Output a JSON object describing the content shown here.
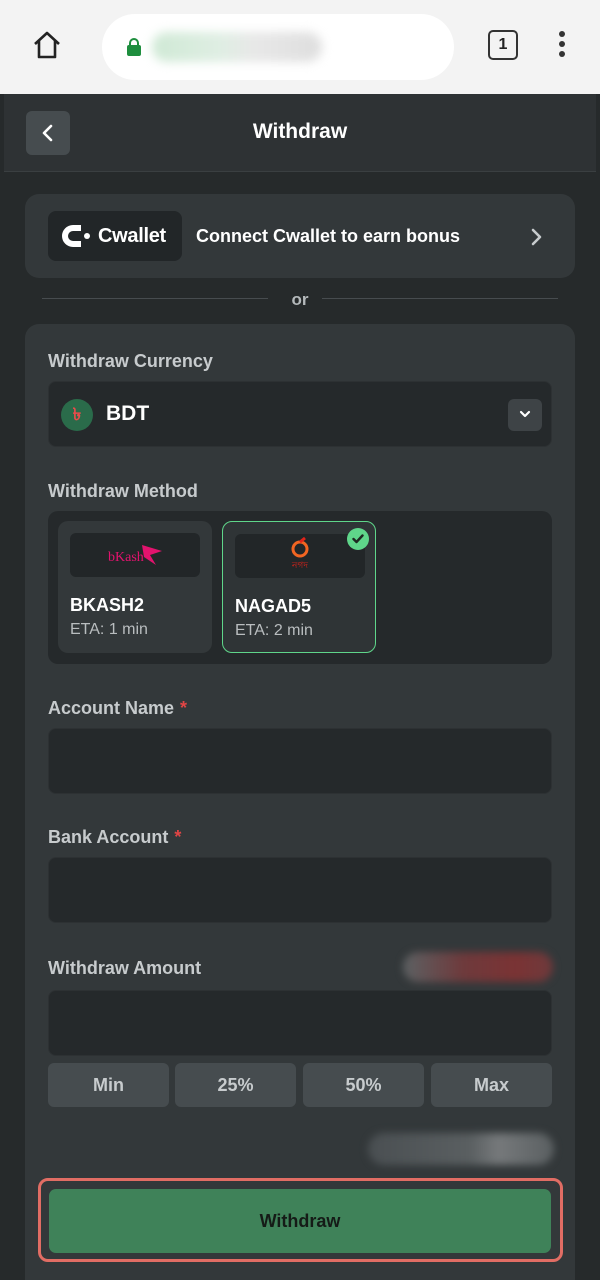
{
  "browser": {
    "tab_count": "1"
  },
  "header": {
    "title": "Withdraw"
  },
  "cwallet": {
    "brand": "Cwallet",
    "cta": "Connect Cwallet to earn bonus"
  },
  "divider_text": "or",
  "form": {
    "currency": {
      "label": "Withdraw Currency",
      "selected": "BDT",
      "symbol": "৳"
    },
    "method": {
      "label": "Withdraw Method",
      "options": [
        {
          "name": "BKASH2",
          "eta": "ETA: 1 min",
          "logo_text": "bKash",
          "selected": false
        },
        {
          "name": "NAGAD5",
          "eta": "ETA: 2 min",
          "logo_text": "নগদ",
          "selected": true
        }
      ]
    },
    "account_name": {
      "label": "Account Name",
      "required": "*",
      "value": ""
    },
    "bank_account": {
      "label": "Bank Account",
      "required": "*",
      "value": ""
    },
    "amount": {
      "label": "Withdraw Amount",
      "value": "",
      "quick_buttons": [
        "Min",
        "25%",
        "50%",
        "Max"
      ]
    },
    "submit_label": "Withdraw"
  },
  "colors": {
    "accent_green": "#5fd68a",
    "submit_green": "#3f8259",
    "required_red": "#e24545",
    "highlight_frame": "#e16d64"
  }
}
